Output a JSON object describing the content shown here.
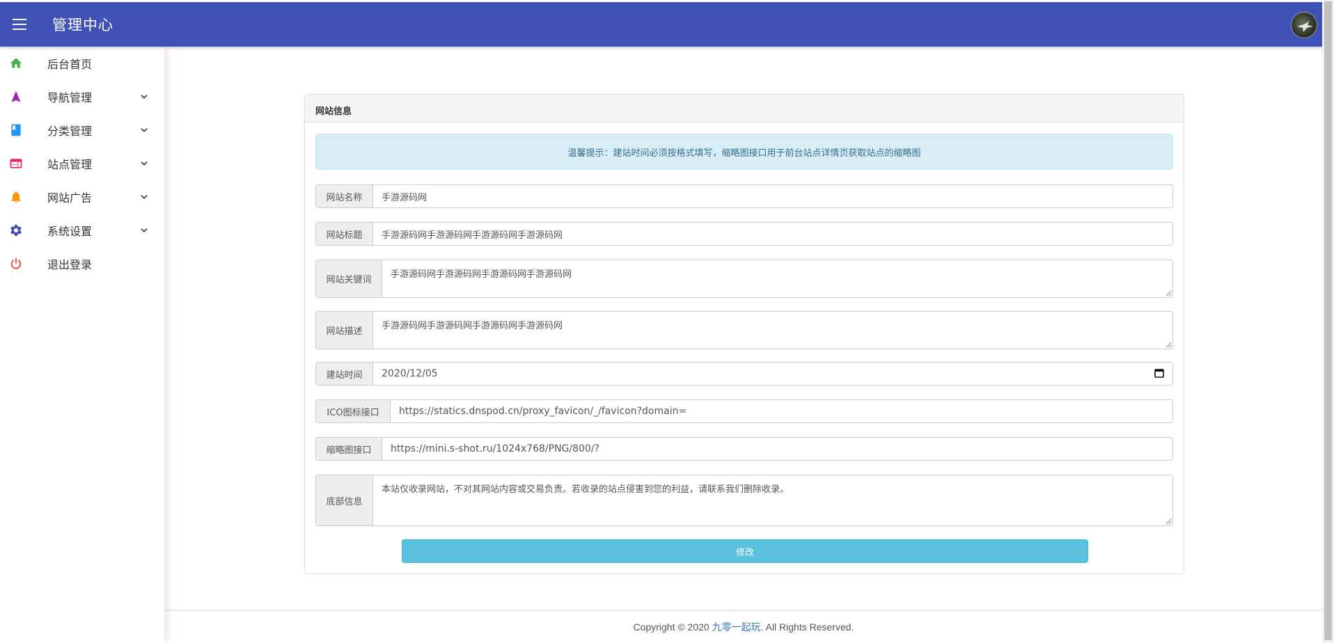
{
  "header": {
    "title": "管理中心"
  },
  "sidebar": {
    "items": [
      {
        "label": "后台首页",
        "has_submenu": false,
        "icon": "home-icon",
        "color": "#4caf50"
      },
      {
        "label": "导航管理",
        "has_submenu": true,
        "icon": "navigation-icon",
        "color": "#9c27b0"
      },
      {
        "label": "分类管理",
        "has_submenu": true,
        "icon": "book-icon",
        "color": "#2196f3"
      },
      {
        "label": "站点管理",
        "has_submenu": true,
        "icon": "web-icon",
        "color": "#e91e63"
      },
      {
        "label": "网站广告",
        "has_submenu": true,
        "icon": "bell-icon",
        "color": "#ff9800"
      },
      {
        "label": "系统设置",
        "has_submenu": true,
        "icon": "gear-icon",
        "color": "#3f51b5"
      },
      {
        "label": "退出登录",
        "has_submenu": false,
        "icon": "power-icon",
        "color": "#f44336"
      }
    ]
  },
  "panel": {
    "heading": "网站信息",
    "alert": "温馨提示：建站时间必须按格式填写，缩略图接口用于前台站点详情页获取站点的缩略图",
    "fields": {
      "name": {
        "label": "网站名称",
        "value": "手游源码网"
      },
      "title": {
        "label": "网站标题",
        "value": "手游源码网手游源码网手游源码网手游源码网"
      },
      "keywords": {
        "label": "网站关键词",
        "value": "手游源码网手游源码网手游源码网手游源码网"
      },
      "description": {
        "label": "网站描述",
        "value": "手游源码网手游源码网手游源码网手游源码网"
      },
      "build_date": {
        "label": "建站时间",
        "value": "2020/12/05"
      },
      "ico_api": {
        "label": "ICO图标接口",
        "value": "https://statics.dnspod.cn/proxy_favicon/_/favicon?domain="
      },
      "thumb_api": {
        "label": "缩略图接口",
        "value": "https://mini.s-shot.ru/1024x768/PNG/800/?"
      },
      "footer_info": {
        "label": "底部信息",
        "value": "本站仅收录网站，不对其网站内容或交易负责。若收录的站点侵害到您的利益，请联系我们删除收录。"
      }
    },
    "submit_label": "修改"
  },
  "footer": {
    "prefix": "Copyright © 2020 ",
    "link_text": "九零一起玩",
    "suffix": ". All Rights Reserved."
  },
  "colors": {
    "primary": "#3f51b5",
    "info": "#5bc0de",
    "alert_bg": "#d9edf7",
    "alert_text": "#31708f"
  }
}
